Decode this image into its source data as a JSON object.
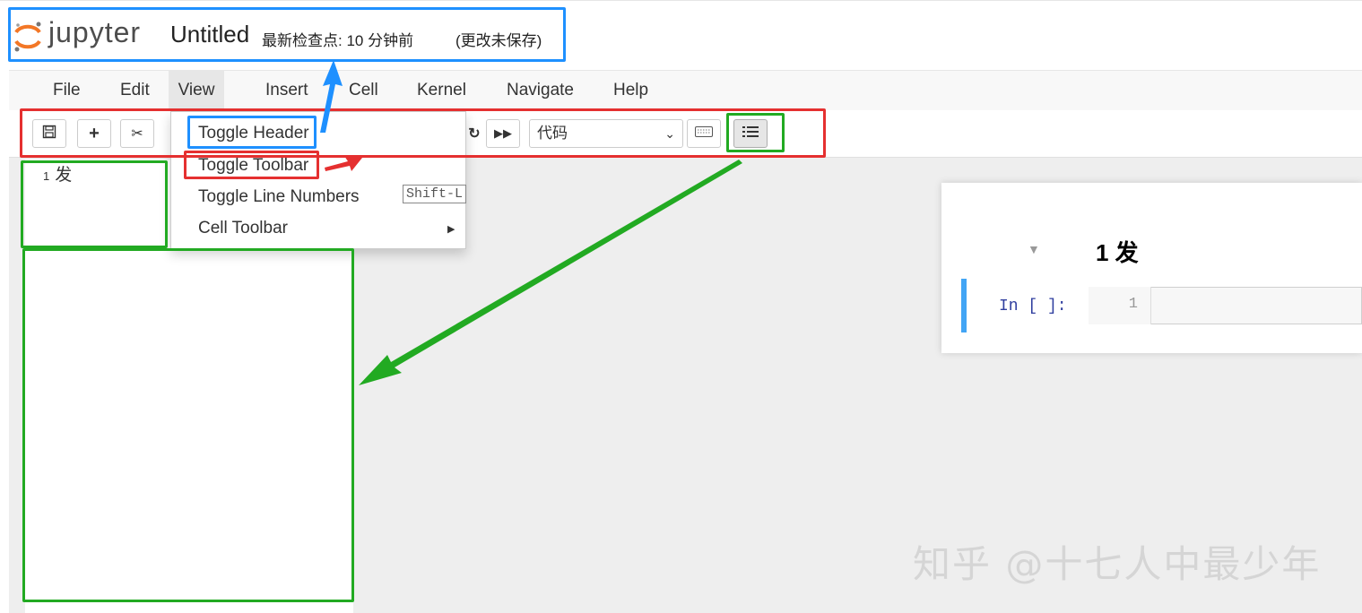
{
  "header": {
    "logo_text": "jupyter",
    "notebook_title": "Untitled",
    "checkpoint": "最新检查点: 10 分钟前",
    "unsaved": "(更改未保存)"
  },
  "menubar": {
    "items": [
      "File",
      "Edit",
      "View",
      "Insert",
      "Cell",
      "Kernel",
      "Navigate",
      "Help"
    ],
    "active": "View"
  },
  "toolbar": {
    "cell_type_value": "代码"
  },
  "view_menu": {
    "items": [
      {
        "label": "Toggle Header"
      },
      {
        "label": "Toggle Toolbar"
      },
      {
        "label": "Toggle Line Numbers",
        "shortcut": "Shift-L"
      },
      {
        "label": "Cell Toolbar",
        "has_submenu": true
      }
    ]
  },
  "toc": {
    "entry_number": "1",
    "entry_text": "发"
  },
  "notebook": {
    "heading": "1 发",
    "prompt": "In [ ]:",
    "line_number": "1"
  },
  "watermark": "知乎 @十七人中最少年",
  "annotation_colors": {
    "blue": "#1e90ff",
    "red": "#e53030",
    "green": "#22aa22"
  }
}
